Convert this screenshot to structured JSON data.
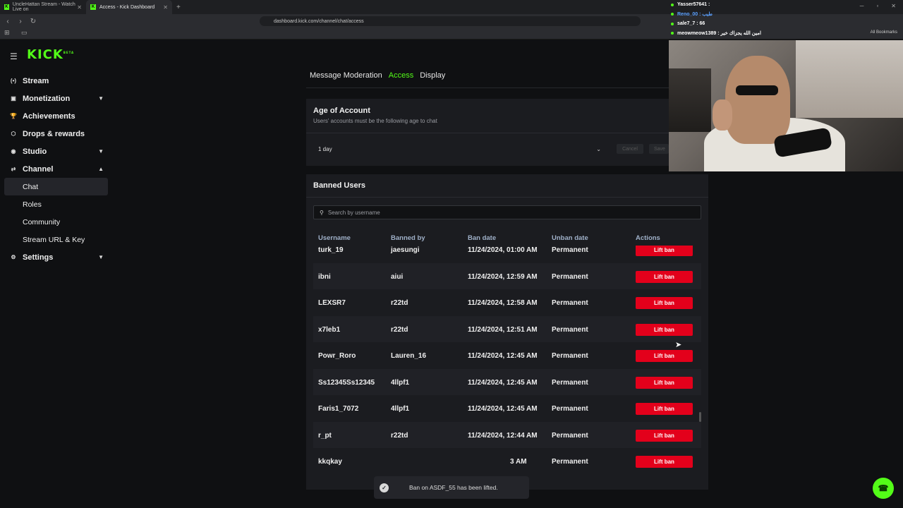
{
  "browser": {
    "tabs": [
      {
        "title": "UncleHattan Stream - Watch Live on"
      },
      {
        "title": "Access - Kick Dashboard"
      }
    ],
    "url": "dashboard.kick.com/channel/chat/access",
    "all_bookmarks": "All Bookmarks"
  },
  "logo": {
    "text": "KICK",
    "beta": "BETA"
  },
  "sidebar": {
    "items": [
      {
        "label": "Stream",
        "icon": "broadcast-icon",
        "glyph": "(•)",
        "chev": ""
      },
      {
        "label": "Monetization",
        "icon": "money-icon",
        "glyph": "▣",
        "chev": "▼"
      },
      {
        "label": "Achievements",
        "icon": "trophy-icon",
        "glyph": "🏆",
        "chev": ""
      },
      {
        "label": "Drops & rewards",
        "icon": "gift-icon",
        "glyph": "⬡",
        "chev": ""
      },
      {
        "label": "Studio",
        "icon": "studio-icon",
        "glyph": "◉",
        "chev": "▼"
      },
      {
        "label": "Channel",
        "icon": "channel-icon",
        "glyph": "⇄",
        "chev": "▲"
      }
    ],
    "subitems": [
      {
        "label": "Chat"
      },
      {
        "label": "Roles"
      },
      {
        "label": "Community"
      },
      {
        "label": "Stream URL & Key"
      }
    ],
    "settings": {
      "label": "Settings",
      "glyph": "⚙",
      "chev": "▼"
    }
  },
  "subnav": {
    "tabs": [
      {
        "label": "Message Moderation",
        "active": false
      },
      {
        "label": "Access",
        "active": true
      },
      {
        "label": "Display",
        "active": false
      }
    ]
  },
  "age_card": {
    "title": "Age of Account",
    "description": "Users' accounts must be the following age to chat",
    "selected": "1 day",
    "cancel": "Cancel",
    "save": "Save"
  },
  "banned": {
    "title": "Banned Users",
    "search_placeholder": "Search by username",
    "columns": [
      "Username",
      "Banned by",
      "Ban date",
      "Unban date",
      "Actions"
    ],
    "rows": [
      {
        "username": "turk_19",
        "banned_by": "jaesungi",
        "ban_date": "11/24/2024, 01:00 AM",
        "unban": "Permanent"
      },
      {
        "username": "ibni",
        "banned_by": "aiui",
        "ban_date": "11/24/2024, 12:59 AM",
        "unban": "Permanent"
      },
      {
        "username": "LEXSR7",
        "banned_by": "r22td",
        "ban_date": "11/24/2024, 12:58 AM",
        "unban": "Permanent"
      },
      {
        "username": "x7leb1",
        "banned_by": "r22td",
        "ban_date": "11/24/2024, 12:51 AM",
        "unban": "Permanent"
      },
      {
        "username": "Powr_Roro",
        "banned_by": "Lauren_16",
        "ban_date": "11/24/2024, 12:45 AM",
        "unban": "Permanent"
      },
      {
        "username": "Ss12345Ss12345",
        "banned_by": "4llpf1",
        "ban_date": "11/24/2024, 12:45 AM",
        "unban": "Permanent"
      },
      {
        "username": "Faris1_7072",
        "banned_by": "4llpf1",
        "ban_date": "11/24/2024, 12:45 AM",
        "unban": "Permanent"
      },
      {
        "username": "r_pt",
        "banned_by": "r22td",
        "ban_date": "11/24/2024, 12:44 AM",
        "unban": "Permanent"
      },
      {
        "username": "kkqkay",
        "banned_by": "",
        "ban_date": "3 AM",
        "unban": "Permanent"
      }
    ],
    "lift_label": "Lift ban"
  },
  "toast": {
    "message": "Ban on ASDF_55 has been lifted."
  },
  "overlay_chat": [
    {
      "text": "Yasser57641 :"
    },
    {
      "text": "Reno_00 : طيب"
    },
    {
      "text": "sale7_7 : 66"
    },
    {
      "text": "meowmeow1389 : امين الله يجزاك خير"
    }
  ],
  "colors": {
    "accent": "#53fc18",
    "danger": "#e3001b",
    "panel": "#1b1c20",
    "background": "#0f1012"
  }
}
